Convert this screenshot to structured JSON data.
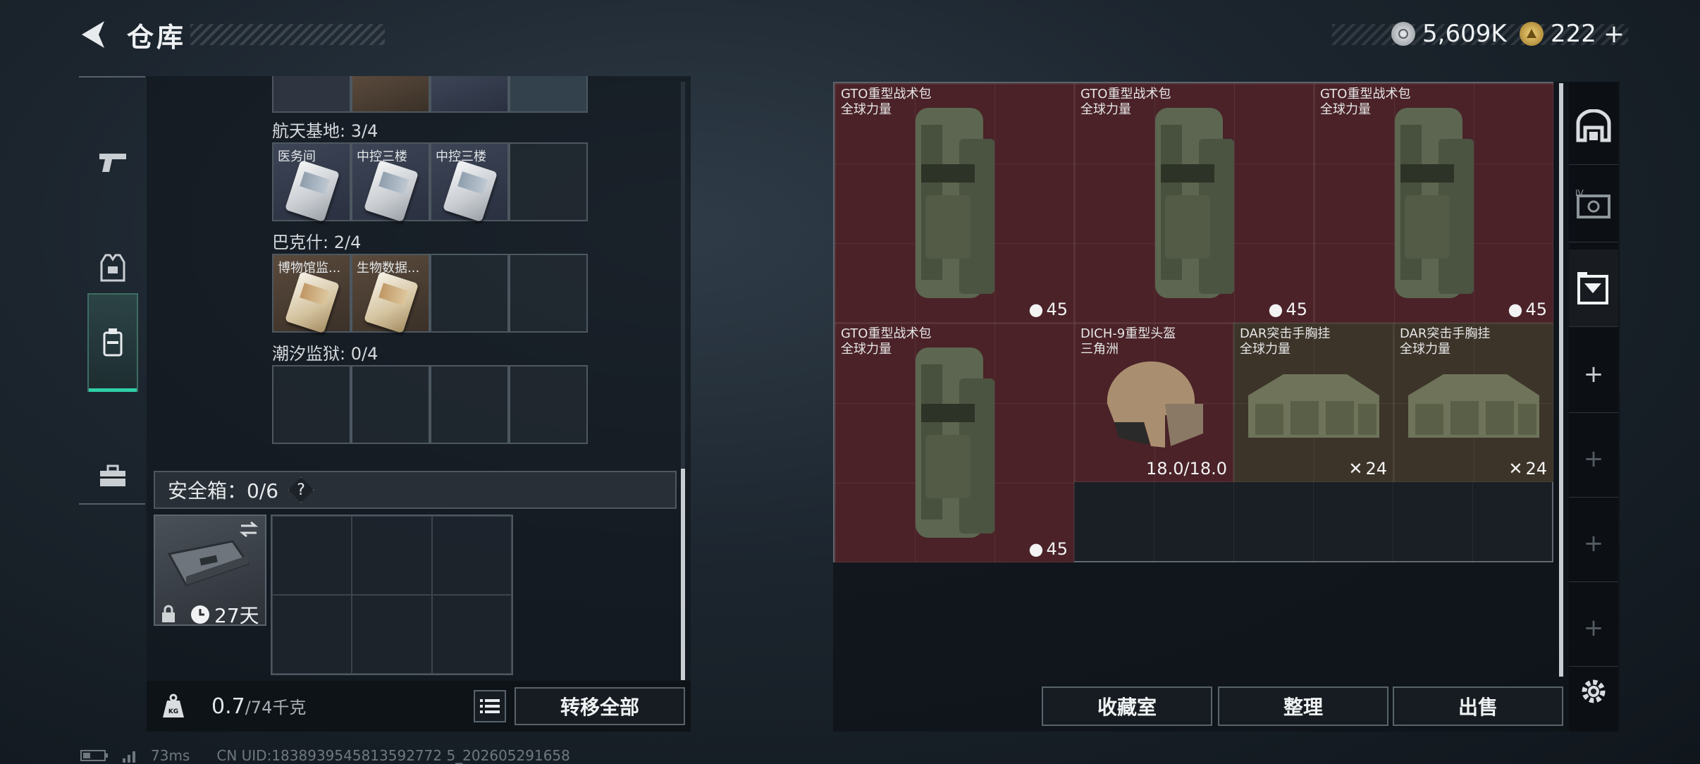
{
  "header": {
    "title": "仓库",
    "currencies": [
      {
        "name": "silver-coin",
        "value": "5,609K",
        "color": "#c9ced3"
      },
      {
        "name": "gold-coin",
        "value": "222",
        "color": "#c9a24a",
        "suffix": "+"
      }
    ]
  },
  "left_tabs": [
    {
      "name": "weapons",
      "icon": "pistol-icon",
      "active": false
    },
    {
      "name": "armor",
      "icon": "vest-icon",
      "active": false
    },
    {
      "name": "keys",
      "icon": "keycard-holder-icon",
      "active": true
    },
    {
      "name": "toolbox",
      "icon": "toolbox-icon",
      "active": false
    }
  ],
  "key_maps": [
    {
      "label": "航天基地: 3/4",
      "cards": [
        {
          "name": "医务间",
          "filled": true,
          "style": "blue"
        },
        {
          "name": "中控三楼",
          "filled": true,
          "style": "blue"
        },
        {
          "name": "中控三楼",
          "filled": true,
          "style": "blue"
        },
        {
          "name": "",
          "filled": false
        }
      ]
    },
    {
      "label": "巴克什: 2/4",
      "cards": [
        {
          "name": "博物馆监...",
          "filled": true,
          "style": "brown"
        },
        {
          "name": "生物数据...",
          "filled": true,
          "style": "brown"
        },
        {
          "name": "",
          "filled": false
        },
        {
          "name": "",
          "filled": false
        }
      ]
    },
    {
      "label": "潮汐监狱: 0/4",
      "cards": [
        {
          "name": "",
          "filled": false
        },
        {
          "name": "",
          "filled": false
        },
        {
          "name": "",
          "filled": false
        },
        {
          "name": "",
          "filled": false
        }
      ]
    }
  ],
  "safe_box": {
    "label": "安全箱：0/6",
    "help": "?",
    "days": "27天"
  },
  "footer": {
    "weight": "0.7",
    "weight_max": "/74千克",
    "transfer_all": "转移全部",
    "weight_icon_label": "KG"
  },
  "stash_items": [
    {
      "name": "GTO重型战术包",
      "sub": "全球力量",
      "value": "45",
      "type": "backpack",
      "bg": "red"
    },
    {
      "name": "GTO重型战术包",
      "sub": "全球力量",
      "value": "45",
      "type": "backpack",
      "bg": "red"
    },
    {
      "name": "GTO重型战术包",
      "sub": "全球力量",
      "value": "45",
      "type": "backpack",
      "bg": "red"
    },
    {
      "name": "GTO重型战术包",
      "sub": "全球力量",
      "value": "45",
      "type": "backpack",
      "bg": "red"
    },
    {
      "name": "DICH-9重型头盔",
      "sub": "三角洲",
      "value": "18.0/18.0",
      "type": "helmet",
      "bg": "red"
    },
    {
      "name": "DAR突击手胸挂",
      "sub": "全球力量",
      "value": "24",
      "type": "chestrig",
      "bg": "brown"
    },
    {
      "name": "DAR突击手胸挂",
      "sub": "全球力量",
      "value": "24",
      "type": "chestrig",
      "bg": "brown"
    }
  ],
  "stash_buttons": {
    "collection": "收藏室",
    "sort": "整理",
    "sell": "出售"
  },
  "status_bar": {
    "ping": "73ms",
    "uid": "CN UID:1838939545813592772 5_202605291658"
  }
}
